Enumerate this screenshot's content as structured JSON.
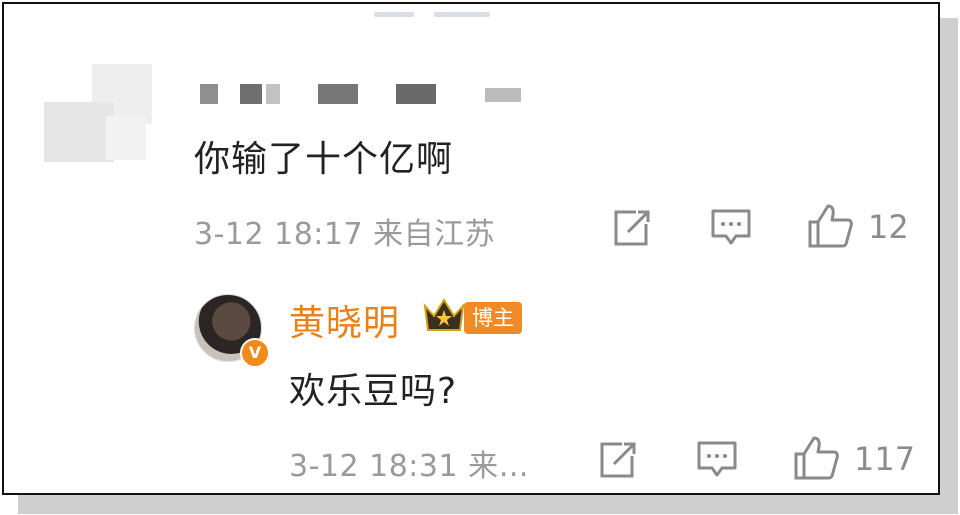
{
  "comment": {
    "username_blurred": "",
    "text": "你输了十个亿啊",
    "time": "3-12 18:17",
    "location": "来自江苏",
    "like_count": "12",
    "icons": [
      "share-icon",
      "reply-icon",
      "like-icon"
    ]
  },
  "reply": {
    "author": "黄晓明",
    "badge": "博主",
    "verified_mark": "V",
    "text": "欢乐豆吗?",
    "time": "3-12 18:31",
    "location": "来…",
    "like_count": "117",
    "icons": [
      "crown-icon",
      "share-icon",
      "reply-icon",
      "like-icon"
    ]
  },
  "colors": {
    "accent": "#e8811a",
    "badge": "#f08a26",
    "meta": "#9a9a9a",
    "text": "#222222"
  }
}
